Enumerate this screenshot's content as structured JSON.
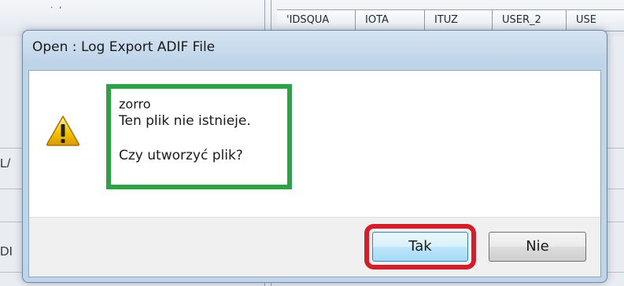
{
  "background_app": {
    "grid_columns": [
      "'IDSQUA",
      "IOTA",
      "ITUZ",
      "USER_2",
      "USE"
    ],
    "left_labels": [
      "L/",
      "DI"
    ]
  },
  "dialog": {
    "title": "Open : Log Export ADIF File",
    "icon": "warning-icon",
    "message": {
      "file_name": "zorro",
      "line1": "Ten plik nie istnieje.",
      "line2": "Czy utworzyć plik?"
    },
    "buttons": {
      "yes_label": "Tak",
      "no_label": "Nie"
    }
  },
  "colors": {
    "highlight_green": "#2ea045",
    "highlight_red": "#d31e2b",
    "warning_yellow": "#f5c400"
  }
}
